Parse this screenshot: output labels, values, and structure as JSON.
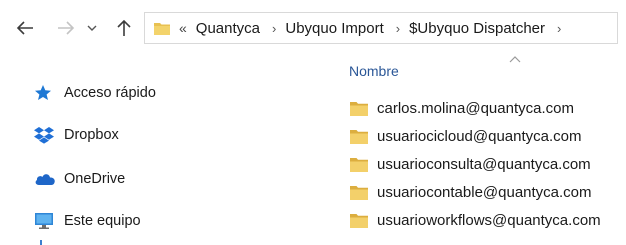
{
  "toolbar": {
    "back_icon": "arrow-left-icon",
    "forward_icon": "arrow-right-icon",
    "recent_icon": "chevron-down-icon",
    "up_icon": "arrow-up-icon"
  },
  "address_bar": {
    "overflow": "«",
    "crumbs": [
      "Quantyca",
      "Ubyquo Import",
      "$Ubyquo Dispatcher"
    ],
    "separator": "›"
  },
  "nav_pane": {
    "items": [
      {
        "label": "Acceso rápido",
        "icon": "star-pin-icon"
      },
      {
        "label": "Dropbox",
        "icon": "dropbox-icon"
      },
      {
        "label": "OneDrive",
        "icon": "cloud-icon"
      },
      {
        "label": "Este equipo",
        "icon": "monitor-icon"
      }
    ]
  },
  "file_list": {
    "column_header": "Nombre",
    "sort": "ascending",
    "items": [
      "carlos.molina@quantyca.com",
      "usuariocicloud@quantyca.com",
      "usuarioconsulta@quantyca.com",
      "usuariocontable@quantyca.com",
      "usuarioworkflows@quantyca.com"
    ]
  },
  "colors": {
    "folder": "#e8c152",
    "accent_blue": "#2b5797",
    "star": "#1e78d4"
  }
}
